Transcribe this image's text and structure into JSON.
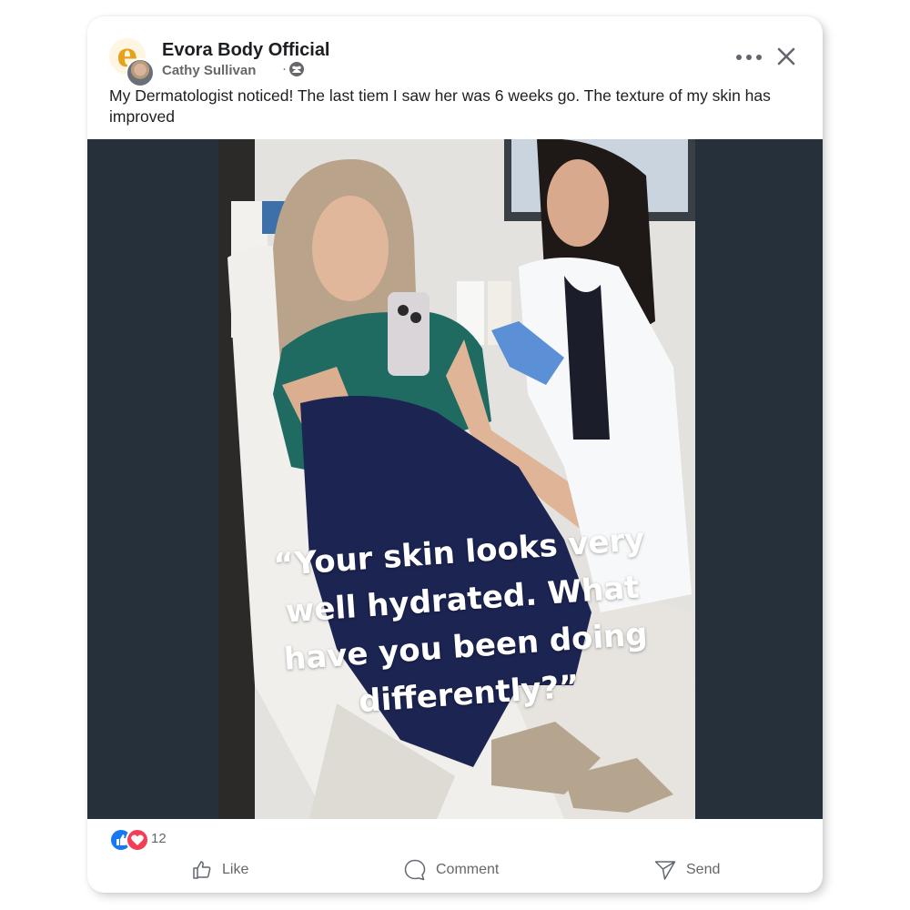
{
  "post": {
    "page_name": "Evora Body Official",
    "page_logo_letter": "e",
    "author": "Cathy Sullivan",
    "separator": "·",
    "caption": "My Dermatologist noticed! The last tiem I saw her was 6 weeks go. The texture of my skin has improved",
    "quote_line1": "“Your skin looks very",
    "quote_line2": "well hydrated. What",
    "quote_line3": "have you been doing",
    "quote_line4": "differently?”"
  },
  "reactions": {
    "count": "12",
    "types": [
      "like-icon",
      "love-icon"
    ]
  },
  "actions": {
    "like": "Like",
    "comment": "Comment",
    "send": "Send"
  },
  "colors": {
    "like_blue": "#1877f2",
    "love_red": "#f33e58",
    "media_background": "#25303a",
    "secondary_text": "#65676b",
    "logo_orange": "#e6a21a"
  }
}
